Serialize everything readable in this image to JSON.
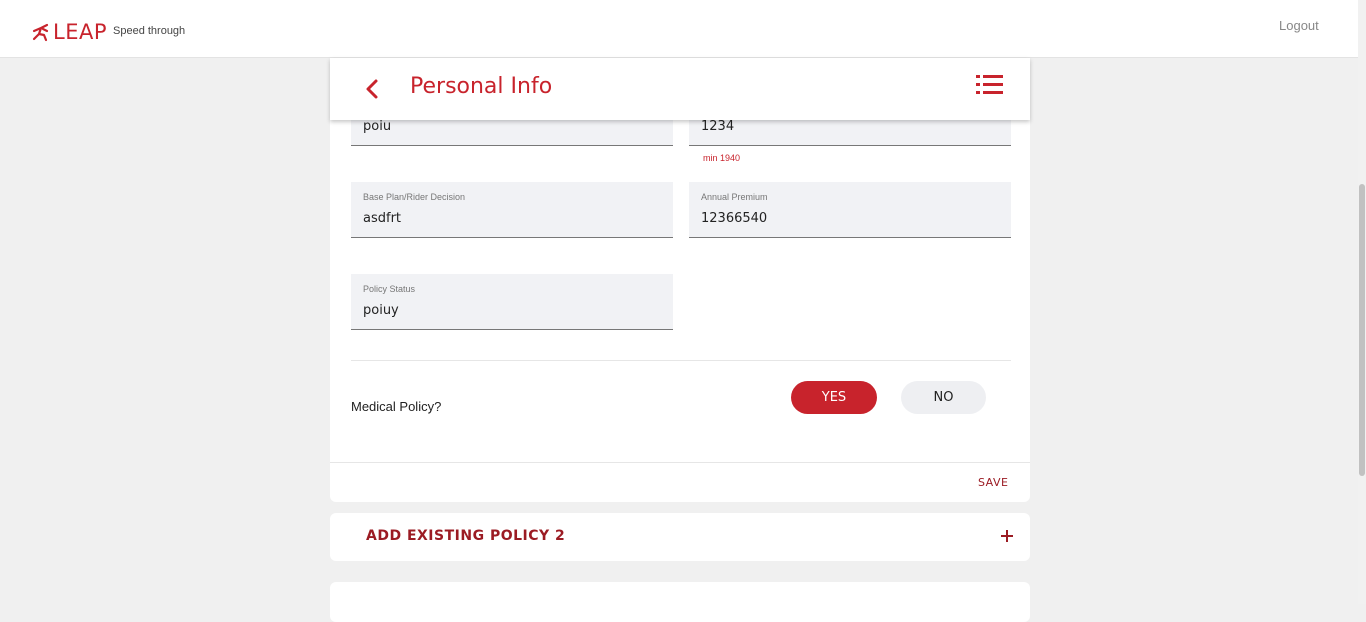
{
  "topbar": {
    "brand": "LEAP",
    "tagline": "Speed through",
    "logout_label": "Logout"
  },
  "header": {
    "title": "Personal Info"
  },
  "form": {
    "field_a_value": "poiu",
    "field_b_value": "1234",
    "field_b_error": "min 1940",
    "base_plan": {
      "label": "Base Plan/Rider Decision",
      "value": "asdfrt"
    },
    "annual_premium": {
      "label": "Annual Premium",
      "value": "12366540"
    },
    "policy_status": {
      "label": "Policy Status",
      "value": "poiuy"
    },
    "medical_question": "Medical Policy?",
    "yes_label": "YES",
    "no_label": "NO",
    "selected": "YES",
    "save_label": "SAVE"
  },
  "accordion": {
    "title": "ADD EXISTING POLICY 2"
  },
  "icons": {
    "logo": "runner-icon",
    "back": "chevron-left-icon",
    "menu": "list-menu-icon",
    "expand": "plus-icon"
  },
  "colors": {
    "brand_red": "#c8232c",
    "dark_red": "#9b1b23",
    "field_bg": "#f1f2f5",
    "page_bg": "#f0f0f0"
  }
}
